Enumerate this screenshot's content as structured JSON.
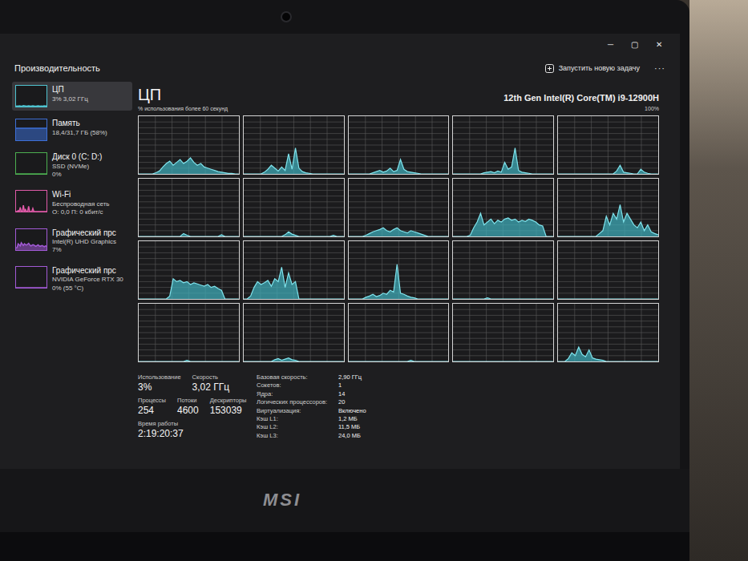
{
  "window": {
    "title": "Производительность",
    "controls": [
      "─",
      "▢",
      "✕"
    ]
  },
  "toolbar": {
    "new_task": "Запустить новую задачу",
    "more": "···"
  },
  "sidebar": {
    "items": [
      {
        "title": "ЦП",
        "lines": [
          "3% 3,02 ГГц"
        ],
        "selected": true,
        "color": "#4fc3d0",
        "values": [
          2,
          3,
          2,
          4,
          3,
          2,
          3,
          5,
          4,
          3,
          2,
          3,
          4,
          3,
          2,
          3,
          4,
          3,
          2,
          2,
          3,
          4,
          3,
          2,
          3,
          2,
          3,
          4,
          3,
          3
        ]
      },
      {
        "title": "Память",
        "lines": [
          "18,4/31,7 ГБ (58%)"
        ],
        "selected": false,
        "color": "#3d6fd6",
        "values": [
          58,
          58,
          58,
          58,
          58,
          58,
          58,
          58,
          58,
          58,
          58,
          58,
          58,
          58,
          58,
          58,
          58,
          58,
          58,
          58,
          58,
          58,
          58,
          58,
          58,
          58,
          58,
          58,
          58,
          58
        ]
      },
      {
        "title": "Диск 0 (C: D:)",
        "lines": [
          "SSD (NVMe)",
          "0%"
        ],
        "selected": false,
        "color": "#4caf50",
        "values": [
          0,
          0,
          0,
          0,
          0,
          0,
          0,
          0,
          0,
          0,
          0,
          0,
          0,
          0,
          0,
          0,
          0,
          0,
          0,
          0,
          0,
          0,
          0,
          0,
          0,
          0,
          0,
          0,
          0,
          0
        ]
      },
      {
        "title": "Wi-Fi",
        "lines": [
          "Беспроводная сеть",
          "О: 0,0 П: 0 кбит/с"
        ],
        "selected": false,
        "color": "#e05aa8",
        "values": [
          0,
          0,
          5,
          0,
          20,
          0,
          0,
          30,
          0,
          10,
          0,
          0,
          25,
          0,
          0,
          0,
          15,
          0,
          0,
          0,
          0,
          0,
          0,
          0,
          0,
          0,
          0,
          0,
          0,
          0
        ]
      },
      {
        "title": "Графический прс",
        "lines": [
          "Intel(R) UHD Graphics",
          "7%"
        ],
        "selected": false,
        "color": "#a25ad6",
        "values": [
          10,
          12,
          30,
          25,
          20,
          35,
          28,
          22,
          30,
          26,
          24,
          28,
          32,
          25,
          20,
          22,
          26,
          24,
          20,
          18,
          22,
          25,
          20,
          18,
          20,
          22,
          18,
          16,
          20,
          18
        ]
      },
      {
        "title": "Графический прс",
        "lines": [
          "NVIDIA GeForce RTX 30",
          "0% (55 °C)"
        ],
        "selected": false,
        "color": "#a25ad6",
        "values": [
          0,
          0,
          0,
          0,
          0,
          0,
          0,
          0,
          0,
          0,
          0,
          0,
          0,
          0,
          0,
          0,
          0,
          0,
          0,
          0,
          0,
          0,
          0,
          0,
          0,
          0,
          0,
          0,
          0,
          0
        ]
      }
    ]
  },
  "main": {
    "title": "ЦП",
    "cpu_name": "12th Gen Intel(R) Core(TM) i9-12900H",
    "graph_caption": "% использования более 60 секунд",
    "max_label": "100%",
    "processors": [
      {
        "values": [
          0,
          0,
          0,
          0,
          0,
          2,
          5,
          12,
          18,
          22,
          15,
          20,
          25,
          18,
          22,
          28,
          20,
          15,
          18,
          12,
          10,
          8,
          6,
          4,
          3,
          2,
          1,
          1,
          0,
          0
        ]
      },
      {
        "values": [
          0,
          0,
          0,
          0,
          0,
          0,
          3,
          8,
          15,
          10,
          5,
          12,
          6,
          35,
          8,
          45,
          10,
          4,
          2,
          1,
          0,
          0,
          0,
          0,
          0,
          0,
          0,
          0,
          0,
          0
        ]
      },
      {
        "values": [
          0,
          0,
          0,
          0,
          0,
          0,
          0,
          2,
          4,
          6,
          3,
          5,
          10,
          4,
          6,
          25,
          8,
          4,
          3,
          2,
          1,
          0,
          0,
          0,
          0,
          0,
          0,
          0,
          0,
          0
        ]
      },
      {
        "values": [
          0,
          0,
          0,
          0,
          0,
          0,
          0,
          0,
          0,
          2,
          3,
          4,
          2,
          5,
          3,
          20,
          8,
          12,
          45,
          6,
          3,
          2,
          1,
          0,
          0,
          0,
          0,
          0,
          0,
          0
        ]
      },
      {
        "values": [
          0,
          0,
          0,
          0,
          0,
          0,
          0,
          0,
          0,
          0,
          0,
          0,
          0,
          0,
          0,
          0,
          0,
          5,
          15,
          3,
          2,
          1,
          0,
          0,
          8,
          3,
          1,
          0,
          0,
          0
        ]
      },
      {
        "values": [
          0,
          0,
          0,
          0,
          0,
          0,
          0,
          0,
          0,
          0,
          0,
          0,
          0,
          5,
          2,
          0,
          0,
          0,
          0,
          0,
          0,
          0,
          0,
          0,
          3,
          0,
          0,
          0,
          0,
          0
        ]
      },
      {
        "values": [
          0,
          0,
          0,
          0,
          0,
          0,
          0,
          0,
          0,
          0,
          0,
          0,
          3,
          8,
          4,
          2,
          0,
          0,
          0,
          0,
          0,
          0,
          0,
          0,
          0,
          0,
          2,
          0,
          0,
          0
        ]
      },
      {
        "values": [
          0,
          0,
          0,
          0,
          0,
          2,
          5,
          8,
          10,
          12,
          15,
          10,
          8,
          12,
          15,
          10,
          8,
          6,
          10,
          8,
          6,
          4,
          2,
          0,
          0,
          0,
          0,
          0,
          0,
          0
        ]
      },
      {
        "values": [
          0,
          0,
          0,
          0,
          0,
          2,
          15,
          25,
          40,
          20,
          25,
          30,
          22,
          28,
          25,
          30,
          32,
          28,
          30,
          25,
          28,
          26,
          30,
          28,
          25,
          20,
          18,
          0,
          0,
          0
        ]
      },
      {
        "values": [
          0,
          0,
          0,
          0,
          0,
          0,
          0,
          0,
          0,
          0,
          0,
          0,
          5,
          10,
          35,
          20,
          40,
          30,
          55,
          25,
          40,
          30,
          20,
          15,
          25,
          10,
          20,
          8,
          5,
          3
        ]
      },
      {
        "values": [
          0,
          0,
          0,
          0,
          0,
          0,
          0,
          0,
          0,
          5,
          35,
          30,
          32,
          28,
          30,
          25,
          28,
          26,
          24,
          22,
          25,
          20,
          22,
          18,
          15,
          0,
          0,
          0,
          0,
          0
        ]
      },
      {
        "values": [
          0,
          0,
          5,
          20,
          30,
          25,
          28,
          32,
          22,
          35,
          30,
          55,
          20,
          45,
          25,
          30,
          0,
          0,
          0,
          0,
          0,
          0,
          0,
          0,
          0,
          0,
          0,
          0,
          0,
          0
        ]
      },
      {
        "values": [
          0,
          0,
          0,
          0,
          0,
          3,
          5,
          8,
          4,
          6,
          10,
          8,
          15,
          12,
          60,
          10,
          8,
          5,
          3,
          2,
          0,
          0,
          0,
          0,
          0,
          0,
          0,
          0,
          0,
          0
        ]
      },
      {
        "values": [
          0,
          0,
          0,
          0,
          0,
          0,
          0,
          0,
          0,
          0,
          2,
          0,
          0,
          0,
          0,
          0,
          0,
          0,
          0,
          0,
          0,
          0,
          0,
          0,
          0,
          0,
          0,
          0,
          0,
          0
        ]
      },
      {
        "values": [
          0,
          0,
          0,
          0,
          0,
          0,
          0,
          0,
          0,
          0,
          0,
          0,
          0,
          0,
          0,
          0,
          0,
          0,
          0,
          0,
          0,
          0,
          0,
          0,
          0,
          0,
          0,
          0,
          0,
          0
        ]
      },
      {
        "values": [
          0,
          0,
          0,
          0,
          0,
          0,
          0,
          0,
          0,
          0,
          0,
          0,
          0,
          0,
          2,
          0,
          0,
          0,
          0,
          0,
          0,
          0,
          0,
          0,
          0,
          0,
          0,
          0,
          0,
          0
        ]
      },
      {
        "values": [
          0,
          0,
          0,
          0,
          0,
          0,
          0,
          0,
          0,
          3,
          5,
          2,
          4,
          6,
          3,
          2,
          0,
          0,
          0,
          0,
          0,
          0,
          0,
          0,
          0,
          0,
          0,
          0,
          0,
          0
        ]
      },
      {
        "values": [
          0,
          0,
          0,
          0,
          0,
          0,
          0,
          0,
          0,
          0,
          0,
          0,
          0,
          0,
          0,
          0,
          0,
          0,
          2,
          0,
          0,
          0,
          0,
          0,
          0,
          0,
          0,
          0,
          0,
          0
        ]
      },
      {
        "values": [
          0,
          0,
          0,
          0,
          0,
          0,
          0,
          0,
          0,
          0,
          0,
          0,
          0,
          0,
          0,
          0,
          0,
          0,
          0,
          0,
          0,
          0,
          0,
          0,
          0,
          0,
          0,
          0,
          0,
          0
        ]
      },
      {
        "values": [
          0,
          0,
          0,
          5,
          15,
          10,
          25,
          12,
          8,
          20,
          6,
          4,
          3,
          2,
          0,
          0,
          0,
          0,
          0,
          0,
          0,
          0,
          0,
          0,
          0,
          0,
          0,
          0,
          0,
          0
        ]
      }
    ]
  },
  "stats": [
    [
      {
        "label": "Использование",
        "value": "3%"
      },
      {
        "label": "Скорость",
        "value": "3,02 ГГц"
      }
    ],
    [
      {
        "label": "Процессы",
        "value": "254"
      },
      {
        "label": "Потоки",
        "value": "4600"
      },
      {
        "label": "Дескрипторы",
        "value": "153039"
      }
    ],
    [
      {
        "label": "Время работы",
        "value": "2:19:20:37"
      }
    ]
  ],
  "details": [
    {
      "label": "Базовая скорость:",
      "value": "2,90 ГГц"
    },
    {
      "label": "Сокетов:",
      "value": "1"
    },
    {
      "label": "Ядра:",
      "value": "14"
    },
    {
      "label": "Логических процессоров:",
      "value": "20"
    },
    {
      "label": "Виртуализация:",
      "value": "Включено"
    },
    {
      "label": "Кэш L1:",
      "value": "1,2 МБ"
    },
    {
      "label": "Кэш L2:",
      "value": "11,5 МБ"
    },
    {
      "label": "Кэш L3:",
      "value": "24,0 МБ"
    }
  ],
  "laptop": {
    "logo": "MSI"
  }
}
